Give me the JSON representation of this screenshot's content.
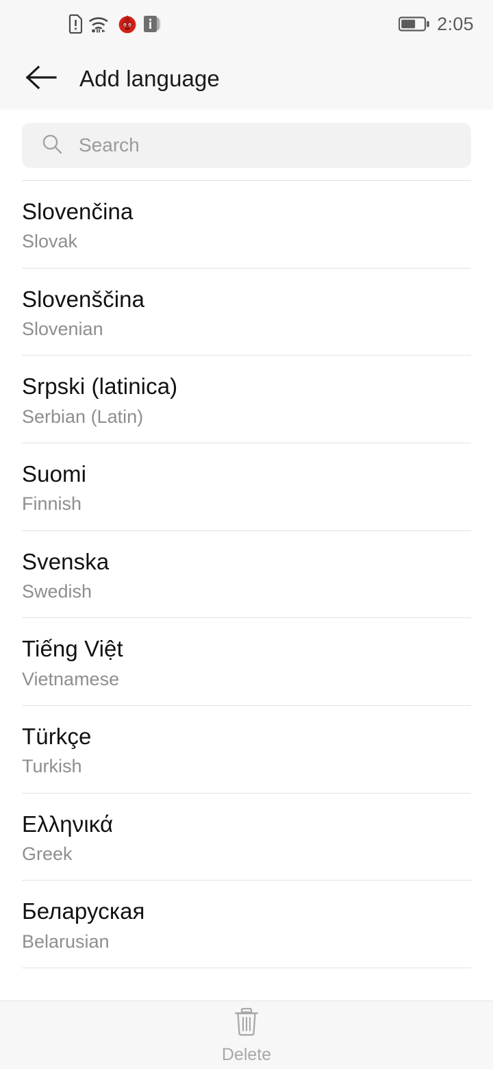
{
  "status_bar": {
    "time": "2:05",
    "icons": [
      {
        "name": "sim-card-alert-icon",
        "color": "#4a4a4a"
      },
      {
        "name": "wifi-icon",
        "color": "#4a4a4a"
      },
      {
        "name": "flame-app-icon",
        "color": "#d32216"
      },
      {
        "name": "info-badge-icon",
        "color": "#6e6e6e"
      }
    ],
    "battery": {
      "name": "battery-icon",
      "level_percent": 58,
      "color": "#5b5b5b"
    }
  },
  "header": {
    "back_icon": "arrow-left-icon",
    "title": "Add language",
    "background": "#f7f7f7"
  },
  "search": {
    "icon": "search-icon",
    "placeholder": "Search",
    "value": "",
    "background": "#f2f2f2"
  },
  "languages": [
    {
      "native": "Slovenčina",
      "english": "Slovak"
    },
    {
      "native": "Slovenščina",
      "english": "Slovenian"
    },
    {
      "native": "Srpski (latinica)",
      "english": "Serbian (Latin)"
    },
    {
      "native": "Suomi",
      "english": "Finnish"
    },
    {
      "native": "Svenska",
      "english": "Swedish"
    },
    {
      "native": "Tiếng Việt",
      "english": "Vietnamese"
    },
    {
      "native": "Türkçe",
      "english": "Turkish"
    },
    {
      "native": "Ελληνικά",
      "english": "Greek"
    },
    {
      "native": "Беларуская",
      "english": "Belarusian"
    }
  ],
  "bottom_bar": {
    "delete": {
      "icon": "trash-icon",
      "label": "Delete",
      "enabled": false,
      "color": "#a8a8a8"
    },
    "background": "#f7f7f7"
  },
  "colors": {
    "page_background": "#ffffff",
    "chrome_background": "#f7f7f7",
    "divider": "#e2e2e2",
    "primary_text": "#111111",
    "secondary_text": "#8e8e8e"
  }
}
